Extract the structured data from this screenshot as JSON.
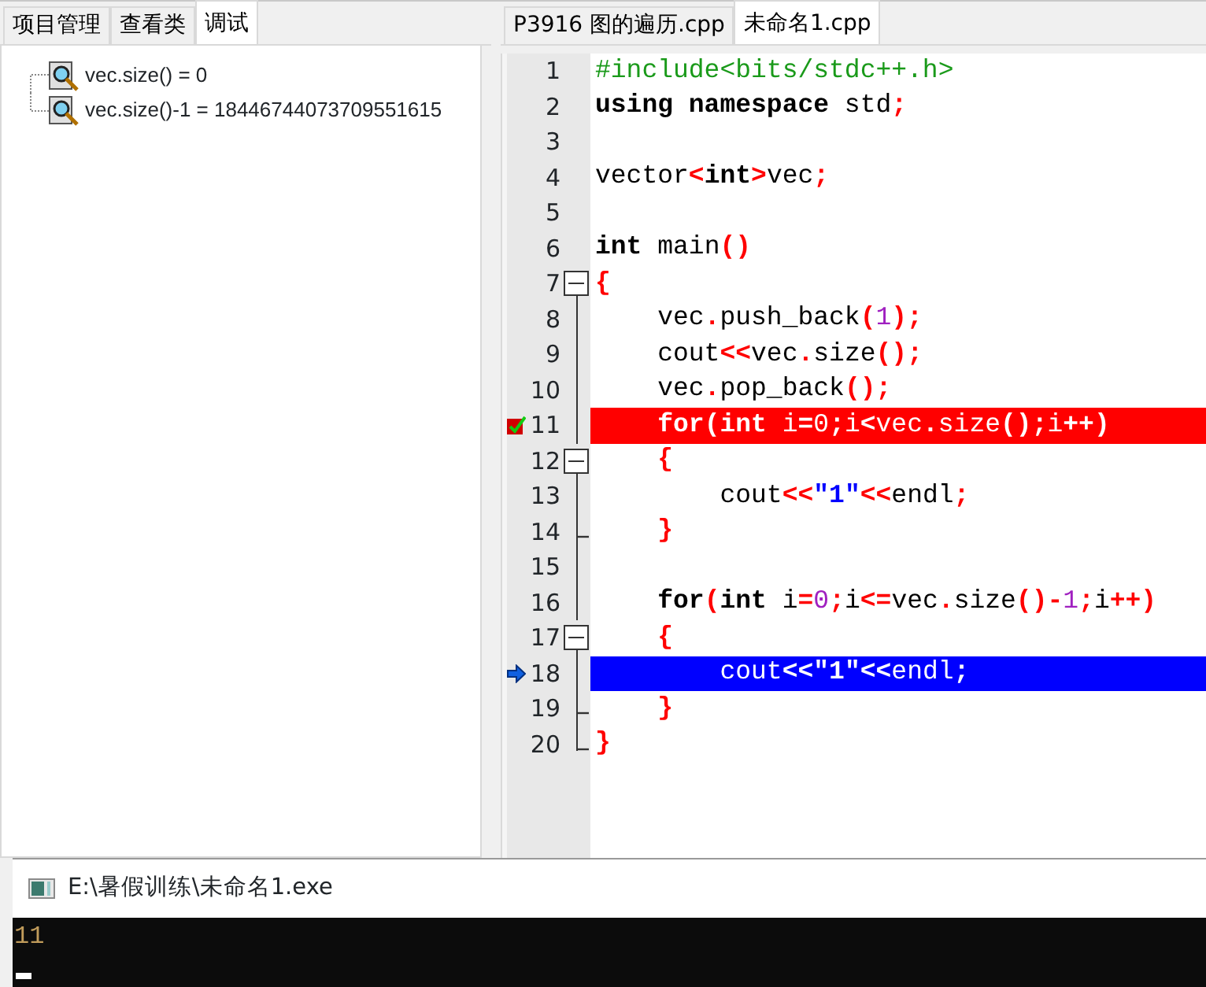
{
  "left_panel": {
    "tabs": [
      {
        "label": "项目管理",
        "selected": false
      },
      {
        "label": "查看类",
        "selected": false
      },
      {
        "label": "调试",
        "selected": true
      }
    ],
    "watches": [
      {
        "text": "vec.size() = 0"
      },
      {
        "text": "vec.size()-1 = 18446744073709551615"
      }
    ]
  },
  "editor": {
    "tabs": [
      {
        "label": "P3916 图的遍历.cpp",
        "selected": false
      },
      {
        "label": "未命名1.cpp",
        "selected": true
      }
    ],
    "lines": [
      {
        "number": "1",
        "breakpoint": false,
        "current": false,
        "tokens": [
          {
            "text": "#include<bits/stdc++.h>",
            "kind": "pre"
          }
        ]
      },
      {
        "number": "2",
        "breakpoint": false,
        "current": false,
        "tokens": [
          {
            "text": "using namespace",
            "kind": "kw"
          },
          {
            "text": " std",
            "kind": "id"
          },
          {
            "text": ";",
            "kind": "sym"
          }
        ]
      },
      {
        "number": "3",
        "breakpoint": false,
        "current": false
      },
      {
        "number": "4",
        "breakpoint": false,
        "current": false,
        "tokens": [
          {
            "text": "vector",
            "kind": "id"
          },
          {
            "text": "<",
            "kind": "sym"
          },
          {
            "text": "int",
            "kind": "kw"
          },
          {
            "text": ">",
            "kind": "sym"
          },
          {
            "text": "vec",
            "kind": "id"
          },
          {
            "text": ";",
            "kind": "sym"
          }
        ]
      },
      {
        "number": "5",
        "breakpoint": false,
        "current": false
      },
      {
        "number": "6",
        "breakpoint": false,
        "current": false,
        "tokens": [
          {
            "text": "int",
            "kind": "kw"
          },
          {
            "text": " main",
            "kind": "id"
          },
          {
            "text": "()",
            "kind": "sym"
          }
        ]
      },
      {
        "number": "7",
        "fold": {
          "kind": "open"
        },
        "breakpoint": false,
        "current": false,
        "tokens": [
          {
            "text": "{",
            "kind": "sym"
          }
        ]
      },
      {
        "number": "8",
        "fold": {
          "kind": "line"
        },
        "breakpoint": false,
        "current": false,
        "tokens": [
          {
            "text": "    vec",
            "kind": "id"
          },
          {
            "text": ".",
            "kind": "sym"
          },
          {
            "text": "push_back",
            "kind": "id"
          },
          {
            "text": "(",
            "kind": "sym"
          },
          {
            "text": "1",
            "kind": "num"
          },
          {
            "text": ");",
            "kind": "sym"
          }
        ]
      },
      {
        "number": "9",
        "fold": {
          "kind": "line"
        },
        "breakpoint": false,
        "current": false,
        "tokens": [
          {
            "text": "    cout",
            "kind": "id"
          },
          {
            "text": "<<",
            "kind": "sym"
          },
          {
            "text": "vec",
            "kind": "id"
          },
          {
            "text": ".",
            "kind": "sym"
          },
          {
            "text": "size",
            "kind": "id"
          },
          {
            "text": "();",
            "kind": "sym"
          }
        ]
      },
      {
        "number": "10",
        "fold": {
          "kind": "line"
        },
        "breakpoint": false,
        "current": false,
        "tokens": [
          {
            "text": "    vec",
            "kind": "id"
          },
          {
            "text": ".",
            "kind": "sym"
          },
          {
            "text": "pop_back",
            "kind": "id"
          },
          {
            "text": "();",
            "kind": "sym"
          }
        ]
      },
      {
        "number": "11",
        "fold": {
          "kind": "line"
        },
        "breakpoint": true,
        "current": false,
        "tokens": [
          {
            "text": "    for",
            "kind": "kw"
          },
          {
            "text": "(",
            "kind": "sym"
          },
          {
            "text": "int",
            "kind": "kw"
          },
          {
            "text": " i",
            "kind": "id"
          },
          {
            "text": "=",
            "kind": "sym"
          },
          {
            "text": "0",
            "kind": "num"
          },
          {
            "text": ";",
            "kind": "sym"
          },
          {
            "text": "i",
            "kind": "id"
          },
          {
            "text": "<",
            "kind": "sym"
          },
          {
            "text": "vec",
            "kind": "id"
          },
          {
            "text": ".",
            "kind": "sym"
          },
          {
            "text": "size",
            "kind": "id"
          },
          {
            "text": "();",
            "kind": "sym"
          },
          {
            "text": "i",
            "kind": "id"
          },
          {
            "text": "++)",
            "kind": "sym"
          }
        ]
      },
      {
        "number": "12",
        "fold": {
          "kind": "open"
        },
        "breakpoint": false,
        "current": false,
        "tokens": [
          {
            "text": "    {",
            "kind": "sym"
          }
        ]
      },
      {
        "number": "13",
        "fold": {
          "kind": "line"
        },
        "breakpoint": false,
        "current": false,
        "tokens": [
          {
            "text": "        cout",
            "kind": "id"
          },
          {
            "text": "<<",
            "kind": "sym"
          },
          {
            "text": "\"1\"",
            "kind": "str"
          },
          {
            "text": "<<",
            "kind": "sym"
          },
          {
            "text": "endl",
            "kind": "id"
          },
          {
            "text": ";",
            "kind": "sym"
          }
        ]
      },
      {
        "number": "14",
        "fold": {
          "kind": "end"
        },
        "breakpoint": false,
        "current": false,
        "tokens": [
          {
            "text": "    }",
            "kind": "sym"
          }
        ]
      },
      {
        "number": "15",
        "fold": {
          "kind": "line"
        },
        "breakpoint": false,
        "current": false
      },
      {
        "number": "16",
        "fold": {
          "kind": "line"
        },
        "breakpoint": false,
        "current": false,
        "tokens": [
          {
            "text": "    for",
            "kind": "kw"
          },
          {
            "text": "(",
            "kind": "sym"
          },
          {
            "text": "int",
            "kind": "kw"
          },
          {
            "text": " i",
            "kind": "id"
          },
          {
            "text": "=",
            "kind": "sym"
          },
          {
            "text": "0",
            "kind": "num"
          },
          {
            "text": ";",
            "kind": "sym"
          },
          {
            "text": "i",
            "kind": "id"
          },
          {
            "text": "<=",
            "kind": "sym"
          },
          {
            "text": "vec",
            "kind": "id"
          },
          {
            "text": ".",
            "kind": "sym"
          },
          {
            "text": "size",
            "kind": "id"
          },
          {
            "text": "()-",
            "kind": "sym"
          },
          {
            "text": "1",
            "kind": "num"
          },
          {
            "text": ";",
            "kind": "sym"
          },
          {
            "text": "i",
            "kind": "id"
          },
          {
            "text": "++)",
            "kind": "sym"
          }
        ]
      },
      {
        "number": "17",
        "fold": {
          "kind": "open"
        },
        "breakpoint": false,
        "current": false,
        "tokens": [
          {
            "text": "    {",
            "kind": "sym"
          }
        ]
      },
      {
        "number": "18",
        "fold": {
          "kind": "line"
        },
        "breakpoint": false,
        "current": true,
        "tokens": [
          {
            "text": "        cout",
            "kind": "id"
          },
          {
            "text": "<<",
            "kind": "sym"
          },
          {
            "text": "\"1\"",
            "kind": "str"
          },
          {
            "text": "<<",
            "kind": "sym"
          },
          {
            "text": "endl",
            "kind": "id"
          },
          {
            "text": ";",
            "kind": "sym"
          }
        ]
      },
      {
        "number": "19",
        "fold": {
          "kind": "end"
        },
        "breakpoint": false,
        "current": false,
        "tokens": [
          {
            "text": "    }",
            "kind": "sym"
          }
        ]
      },
      {
        "number": "20",
        "fold": {
          "kind": "last"
        },
        "breakpoint": false,
        "current": false,
        "tokens": [
          {
            "text": "}",
            "kind": "sym"
          }
        ]
      }
    ]
  },
  "console": {
    "title": "E:\\暑假训练\\未命名1.exe",
    "output": "11"
  }
}
